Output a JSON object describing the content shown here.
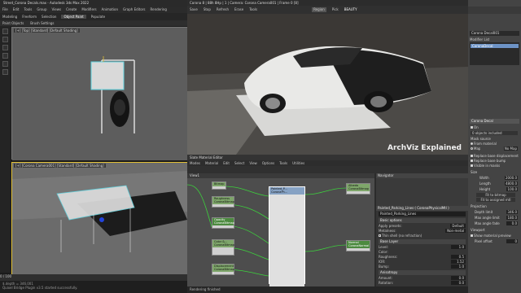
{
  "max": {
    "title": "Street_Corona Decals.max - Autodesk 3ds Max 2022",
    "menu": [
      "File",
      "Edit",
      "Tools",
      "Group",
      "Views",
      "Create",
      "Modifiers",
      "Animation",
      "Graph Editors",
      "Rendering"
    ],
    "ribbon_tabs": [
      "Modeling",
      "Freeform",
      "Selection",
      "Object Paint",
      "Populate"
    ],
    "subtabs": [
      "Paint Objects",
      "Brush Settings"
    ],
    "vp_top_label": "[+] [Top] [Standard] [Default Shading]",
    "vp_cam_label": "[+] [Corona Camera001] [Standard] [Default Shading]",
    "timeline_frame": "0 / 100",
    "status": [
      "$.depth = 346.001",
      "Quixel Bridge Plugin v3.5 started successfully."
    ]
  },
  "vfb": {
    "title": "Corona 8 | 88h 8Hp | 1 | Camera: Corona Camera001 | Frame 0 [8]",
    "toolbar": [
      "Save",
      "Stop",
      "Refresh",
      "Erase",
      "Tools",
      "Region",
      "Pick",
      "BEAUTY"
    ],
    "watermark": "ArchViz Explained"
  },
  "sme": {
    "title": "Slate Material Editor",
    "menu": [
      "Modes",
      "Material",
      "Edit",
      "Select",
      "View",
      "Options",
      "Tools",
      "Utilities"
    ],
    "view_tab": "View1",
    "nodes": {
      "top": "Bitmap",
      "roughness": "Roughness\nCoronaBitmap",
      "opacity": "Opacity\nCoronaBitmap",
      "color": "Color &...\nCoronaBitmap",
      "displacement": "Displacement\nCoronaBitmap",
      "main": "Painted_P...\nCoronaPh...",
      "albedo": "Albedo\nCoronaBitmap",
      "normal": "Normal\nCoronaNormal"
    },
    "nav_title": "Navigator",
    "params_title": "Painted_Parking_Lines ( CoronaPhysicalMtl )",
    "material_name": "Painted_Parking_Lines",
    "basic_options": "Basic options",
    "apply_presets_label": "Apply presets:",
    "apply_presets_value": "Default",
    "metalness_label": "Metalness:",
    "metalness_value": "Non-metal",
    "thin_shell_label": "Thin shell (no refraction)",
    "base_layer": "Base Layer",
    "level_label": "Level:",
    "level_value": "1.0",
    "color_label": "Color:",
    "roughness_label": "Roughness:",
    "roughness_value": "0.5",
    "ior_label": "IOR:",
    "ior_value": "1.52",
    "bump_label": "Bump:",
    "bump_value": "1.0",
    "anisotropy": "Anisotropy",
    "amount_label": "Amount:",
    "amount_value": "0.0",
    "rotation_label": "Rotation:",
    "rotation_value": "0.0",
    "translucency": "Translucency",
    "status": "Rendering finished"
  },
  "cmd": {
    "object_name": "Corona Decal001",
    "modifier_list_label": "Modifier List",
    "modifier_item": "CoronaDecal",
    "rollout": "Corona Decal",
    "on_label": "On",
    "include_label": "0 objects included",
    "mask_source_label": "Mask source",
    "from_material": "From material",
    "map_label": "Map",
    "map_value": "No Map",
    "replace_base": "Replace base displacement",
    "replace_bump": "Replace base bump",
    "visible_in_masks": "Visible in masks",
    "size_label": "Size",
    "width_label": "Width",
    "width_value": "2000.0",
    "length_label": "Length",
    "length_value": "4800.0",
    "height_label": "Height",
    "height_value": "100.0",
    "fit_bitmap": "Fit to bitmap",
    "fit_material": "Fit to assigned mtl",
    "projection_label": "Projection",
    "depth_label": "Depth limit",
    "depth_value": "346.0",
    "max_angle_label": "Max angle limit",
    "max_angle_value": "180.0",
    "max_angle_fade_label": "Max angle fade",
    "max_angle_fade_value": "0.0",
    "viewport_label": "Viewport",
    "show_preview": "Show material preview",
    "pixel_offset_label": "Pixel offset",
    "pixel_offset_value": "0"
  },
  "colors": {
    "selection": "#6d93c6",
    "camera_border": "#e2c036",
    "decal_cyan": "#5fd3e0",
    "node_green": "#7ea66a"
  }
}
